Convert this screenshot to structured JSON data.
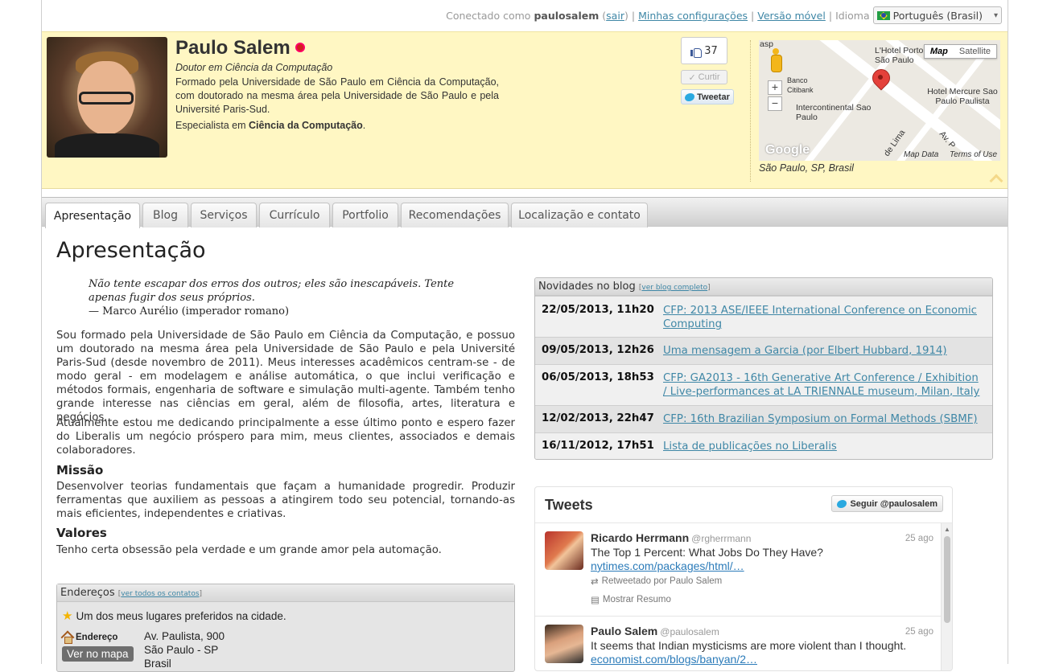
{
  "topbar": {
    "connected_prefix": "Conectado como",
    "username": "paulosalem",
    "logout": "sair",
    "settings": "Minhas configurações",
    "mobile": "Versão móvel",
    "language_label": "Idioma",
    "language_value": "Português (Brasil)"
  },
  "profile": {
    "name": "Paulo Salem",
    "headline": "Doutor em Ciência da Computação",
    "bio": "Formado pela Universidade de São Paulo em Ciência da Computação, com doutorado na mesma área pela Universidade de São Paulo e pela Université Paris-Sud.",
    "specialist_prefix": "Especialista em",
    "specialist_field": "Ciência da Computação",
    "like_count": "37",
    "curtir": "Curtir",
    "tweetar": "Tweetar"
  },
  "map": {
    "mode_map": "Map",
    "mode_satellite": "Satellite",
    "zoom_in": "+",
    "zoom_out": "−",
    "labels": [
      "L'Hotel Porto Bay São Paulo",
      "Banco Citibank",
      "Intercontinental Sao Paulo",
      "Hotel Mercure Sao Paulo Paulista",
      "Av. P",
      "de Lima",
      "asp"
    ],
    "google": "Google",
    "map_data": "Map Data",
    "terms": "Terms of Use",
    "caption": "São Paulo, SP, Brasil"
  },
  "tabs": [
    "Apresentação",
    "Blog",
    "Serviços",
    "Currículo",
    "Portfolio",
    "Recomendações",
    "Localização e contato"
  ],
  "content": {
    "title": "Apresentação",
    "quote_line1": "Não tente escapar dos erros dos outros; eles são inescapáveis. Tente",
    "quote_line2": "apenas fugir dos seus próprios.",
    "quote_author": "— Marco Aurélio (imperador romano)",
    "para1": "Sou formado pela Universidade de São Paulo em Ciência da Computação, e possuo um doutorado na mesma área pela Universidade de São Paulo e pela Université Paris-Sud (desde novembro de 2011). Meus interesses acadêmicos centram-se - de modo geral - em modelagem e análise automática, o que inclui verificação e métodos formais, engenharia de software e simulação multi-agente. Também tenho grande interesse nas ciências em geral, além de filosofia, artes, literatura e negócios.",
    "para2": "Atualmente estou me dedicando principalmente a esse último ponto e espero fazer do Liberalis um negócio próspero para mim, meus clientes, associados e demais colaboradores.",
    "mission_title": "Missão",
    "mission_text": "Desenvolver teorias fundamentais que façam a humanidade progredir. Produzir ferramentas que auxiliem as pessoas a atingirem todo seu potencial, tornando-as mais eficientes, independentes e criativas.",
    "values_title": "Valores",
    "values_text": "Tenho certa obsessão pela verdade e um grande amor pela automação."
  },
  "addresses": {
    "title": "Endereços",
    "link": "ver todos os contatos",
    "favorite": "Um dos meus lugares preferidos na cidade.",
    "label": "Endereço",
    "map_button": "Ver no mapa",
    "line1": "Av. Paulista, 900",
    "line2": "São Paulo - SP",
    "line3": "Brasil"
  },
  "blog": {
    "title": "Novidades no blog",
    "link": "ver blog completo",
    "posts": [
      {
        "date": "22/05/2013, 11h20",
        "title": "CFP: 2013 ASE/IEEE International Conference on Economic Computing"
      },
      {
        "date": "09/05/2013, 12h26",
        "title": "Uma mensagem a Garcia (por Elbert Hubbard, 1914)"
      },
      {
        "date": "06/05/2013, 18h53",
        "title": "CFP: GA2013 - 16th Generative Art Conference / Exhibition / Live-performances at LA TRIENNALE museum, Milan, Italy"
      },
      {
        "date": "12/02/2013, 22h47",
        "title": "CFP: 16th Brazilian Symposium on Formal Methods (SBMF)"
      },
      {
        "date": "16/11/2012, 17h51",
        "title": "Lista de publicações no Liberalis"
      }
    ]
  },
  "tweets": {
    "title": "Tweets",
    "follow": "Seguir @paulosalem",
    "items": [
      {
        "name": "Ricardo Herrmann",
        "handle": "@rgherrmann",
        "time": "25 ago",
        "text": "The Top 1 Percent: What Jobs Do They Have?",
        "link": "nytimes.com/packages/html/…",
        "retweeted": "Retweetado por Paulo Salem",
        "summary": "Mostrar Resumo"
      },
      {
        "name": "Paulo Salem",
        "handle": "@paulosalem",
        "time": "25 ago",
        "text": "It seems that Indian mysticisms are more violent than I thought.",
        "link": "economist.com/blogs/banyan/2…"
      }
    ]
  }
}
